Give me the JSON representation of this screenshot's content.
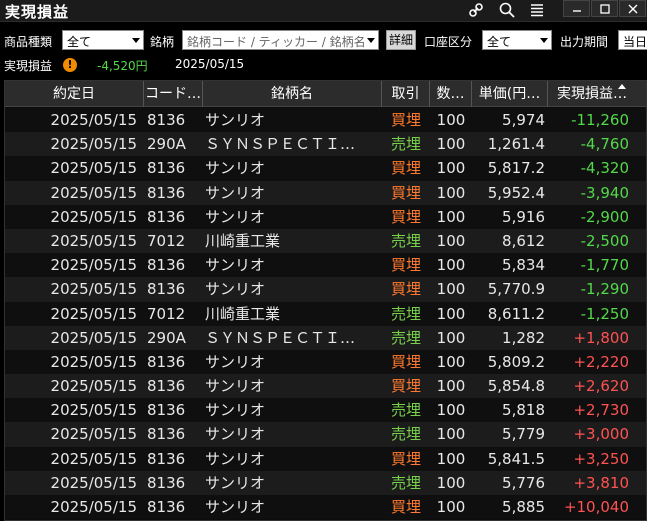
{
  "window": {
    "title": "実現損益"
  },
  "filters": [
    {
      "label": "商品種類",
      "value": "全て"
    },
    {
      "label": "銘柄",
      "placeholder": "銘柄コード / ティッカー / 銘柄名"
    },
    {
      "button": "詳細"
    },
    {
      "label": "口座区分",
      "value": "全て"
    },
    {
      "label": "出力期間",
      "value": "当日"
    }
  ],
  "summary": {
    "label": "実現損益",
    "value": "-4,520円",
    "date": "2025/05/15"
  },
  "colors": {
    "buy": "#ff7a2e",
    "sell": "#78d14a",
    "loss": "#53d84a",
    "gain": "#ff5252",
    "warn": "#f08a00"
  },
  "icons": [
    "link-icon",
    "search-icon",
    "menu-icon",
    "minimize-icon",
    "maximize-icon",
    "close-icon"
  ],
  "table": {
    "columns": [
      "約定日",
      "コード…",
      "銘柄名",
      "取引",
      "数…",
      "単価(円…",
      "実現損益…"
    ],
    "rows": [
      {
        "date": "2025/05/15",
        "code": "8136",
        "name": "サンリオ",
        "side": "買埋",
        "qty": "100",
        "price": "5,974",
        "pnl": "-11,260"
      },
      {
        "date": "2025/05/15",
        "code": "290A",
        "name": "ＳＹＮＳＰＥＣＴＩ…",
        "side": "売埋",
        "qty": "100",
        "price": "1,261.4",
        "pnl": "-4,760"
      },
      {
        "date": "2025/05/15",
        "code": "8136",
        "name": "サンリオ",
        "side": "買埋",
        "qty": "100",
        "price": "5,817.2",
        "pnl": "-4,320"
      },
      {
        "date": "2025/05/15",
        "code": "8136",
        "name": "サンリオ",
        "side": "買埋",
        "qty": "100",
        "price": "5,952.4",
        "pnl": "-3,940"
      },
      {
        "date": "2025/05/15",
        "code": "8136",
        "name": "サンリオ",
        "side": "買埋",
        "qty": "100",
        "price": "5,916",
        "pnl": "-2,900"
      },
      {
        "date": "2025/05/15",
        "code": "7012",
        "name": "川崎重工業",
        "side": "売埋",
        "qty": "100",
        "price": "8,612",
        "pnl": "-2,500"
      },
      {
        "date": "2025/05/15",
        "code": "8136",
        "name": "サンリオ",
        "side": "買埋",
        "qty": "100",
        "price": "5,834",
        "pnl": "-1,770"
      },
      {
        "date": "2025/05/15",
        "code": "8136",
        "name": "サンリオ",
        "side": "買埋",
        "qty": "100",
        "price": "5,770.9",
        "pnl": "-1,290"
      },
      {
        "date": "2025/05/15",
        "code": "7012",
        "name": "川崎重工業",
        "side": "売埋",
        "qty": "100",
        "price": "8,611.2",
        "pnl": "-1,250"
      },
      {
        "date": "2025/05/15",
        "code": "290A",
        "name": "ＳＹＮＳＰＥＣＴＩ…",
        "side": "売埋",
        "qty": "100",
        "price": "1,282",
        "pnl": "+1,800"
      },
      {
        "date": "2025/05/15",
        "code": "8136",
        "name": "サンリオ",
        "side": "買埋",
        "qty": "100",
        "price": "5,809.2",
        "pnl": "+2,220"
      },
      {
        "date": "2025/05/15",
        "code": "8136",
        "name": "サンリオ",
        "side": "買埋",
        "qty": "100",
        "price": "5,854.8",
        "pnl": "+2,620"
      },
      {
        "date": "2025/05/15",
        "code": "8136",
        "name": "サンリオ",
        "side": "売埋",
        "qty": "100",
        "price": "5,818",
        "pnl": "+2,730"
      },
      {
        "date": "2025/05/15",
        "code": "8136",
        "name": "サンリオ",
        "side": "売埋",
        "qty": "100",
        "price": "5,779",
        "pnl": "+3,000"
      },
      {
        "date": "2025/05/15",
        "code": "8136",
        "name": "サンリオ",
        "side": "買埋",
        "qty": "100",
        "price": "5,841.5",
        "pnl": "+3,250"
      },
      {
        "date": "2025/05/15",
        "code": "8136",
        "name": "サンリオ",
        "side": "売埋",
        "qty": "100",
        "price": "5,776",
        "pnl": "+3,810"
      },
      {
        "date": "2025/05/15",
        "code": "8136",
        "name": "サンリオ",
        "side": "買埋",
        "qty": "100",
        "price": "5,885",
        "pnl": "+10,040"
      }
    ]
  }
}
